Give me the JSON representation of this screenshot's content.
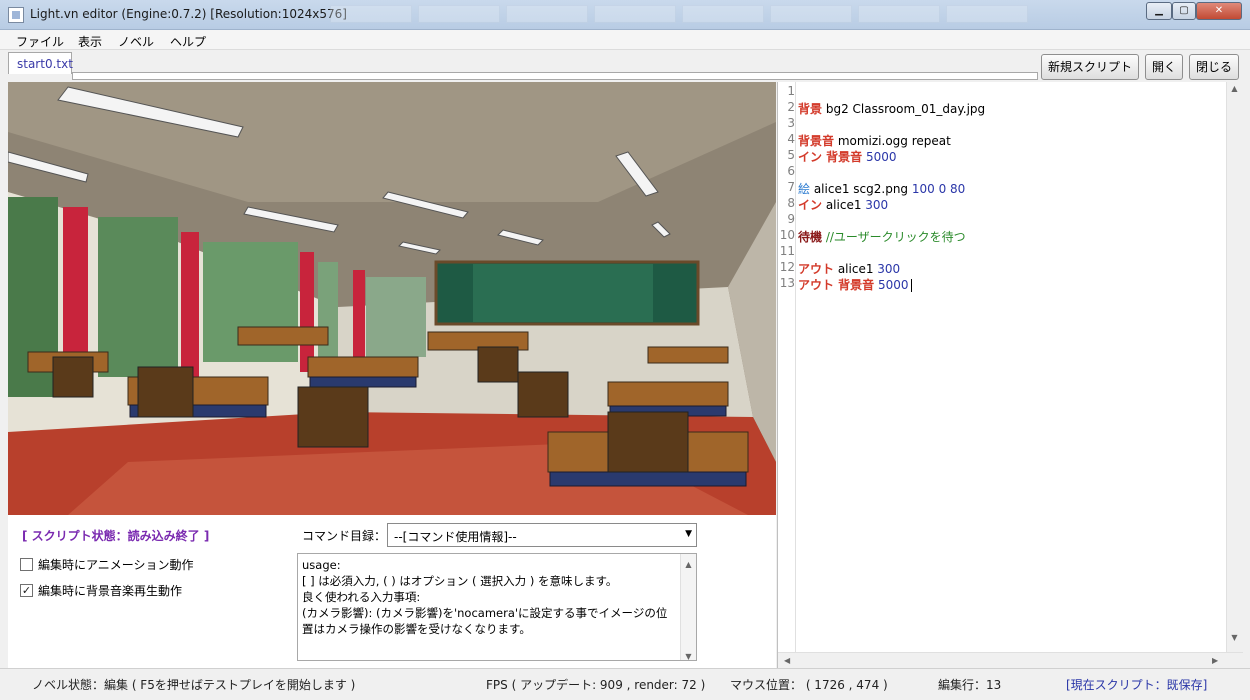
{
  "window": {
    "title": "Light.vn editor (Engine:0.7.2) [Resolution:1024x576]",
    "controls": {
      "minimize": "▁",
      "maximize": "▢",
      "close": "✕"
    }
  },
  "menu": {
    "items": [
      "ファイル",
      "表示",
      "ノベル",
      "ヘルプ"
    ]
  },
  "tab": {
    "label": "start0.txt"
  },
  "buttons": {
    "new_script": "新規スクリプト",
    "open": "開く",
    "close": "閉じる"
  },
  "panel": {
    "script_state": "[ スクリプト状態：読み込み終了 ]",
    "checkbox_animation": {
      "label": "編集時にアニメーション動作",
      "checked": false
    },
    "checkbox_bgm": {
      "label": "編集時に背景音楽再生動作",
      "checked": true
    },
    "command_list_label": "コマンド目録：",
    "command_select_value": "--[コマンド使用情報]--",
    "usage_lines": [
      "usage:",
      "[ ] は必須入力, ( ) はオプション ( 選択入力 ) を意味します。",
      "良く使われる入力事項:",
      "(カメラ影響): (カメラ影響)を'nocamera'に設定する事でイメージの位",
      "置はカメラ操作の影響を受けなくなります。"
    ]
  },
  "editor": {
    "line_numbers": [
      "1",
      "2",
      "3",
      "4",
      "5",
      "6",
      "7",
      "8",
      "9",
      "10",
      "11",
      "12",
      "13"
    ],
    "lines": {
      "l2": {
        "kw": "背景",
        "rest": " bg2 Classroom_01_day.jpg"
      },
      "l4": {
        "kw": "背景音",
        "rest": " momizi.ogg repeat"
      },
      "l5": {
        "kw": "イン 背景音",
        "num": " 5000"
      },
      "l7": {
        "kw": "絵",
        "rest": " alice1 scg2.png",
        "num": " 100 0 80"
      },
      "l8": {
        "kw": "イン",
        "rest": " alice1",
        "num": " 300"
      },
      "l10": {
        "kw": "待機",
        "cmt": " //ユーザークリックを待つ"
      },
      "l12": {
        "kw": "アウト",
        "rest": " alice1",
        "num": " 300"
      },
      "l13": {
        "kw": "アウト 背景音",
        "num": " 5000"
      }
    }
  },
  "status": {
    "novel_state": "ノベル状態：編集 ( F5を押せばテストプレイを開始します )",
    "fps": "FPS ( アップデート: 909 , render: 72 )",
    "mouse": "マウス位置： ( 1726 , 474 )",
    "edit_line": "編集行：13",
    "current_script": "[現在スクリプト：既保存]"
  },
  "colors": {
    "keyword": "#d33a2a",
    "number": "#2a36a8",
    "comment": "#2a8a2a",
    "script_state": "#7a2ab0"
  }
}
